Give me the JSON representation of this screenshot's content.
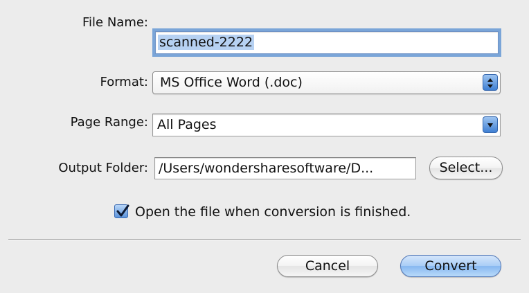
{
  "dialog": {
    "file_name": {
      "label": "File Name:",
      "value": "scanned-2222"
    },
    "format": {
      "label": "Format:",
      "value": "MS Office Word (.doc)"
    },
    "page_range": {
      "label": "Page Range:",
      "value": "All Pages"
    },
    "output_folder": {
      "label": "Output Folder:",
      "value": "/Users/wondersharesoftware/D...",
      "select_label": "Select..."
    },
    "open_after": {
      "label": "Open the file when conversion is finished.",
      "checked": true
    },
    "buttons": {
      "cancel": "Cancel",
      "convert": "Convert"
    }
  },
  "icons": {
    "format_popup": "up-down-arrows-icon",
    "page_range_popup": "chevron-down-icon",
    "checkbox": "checkmark-icon"
  },
  "colors": {
    "background": "#ececec",
    "accent_blue": "#5c93da",
    "focus_ring": "#7aa5d8",
    "selection": "#b6d1f2"
  }
}
